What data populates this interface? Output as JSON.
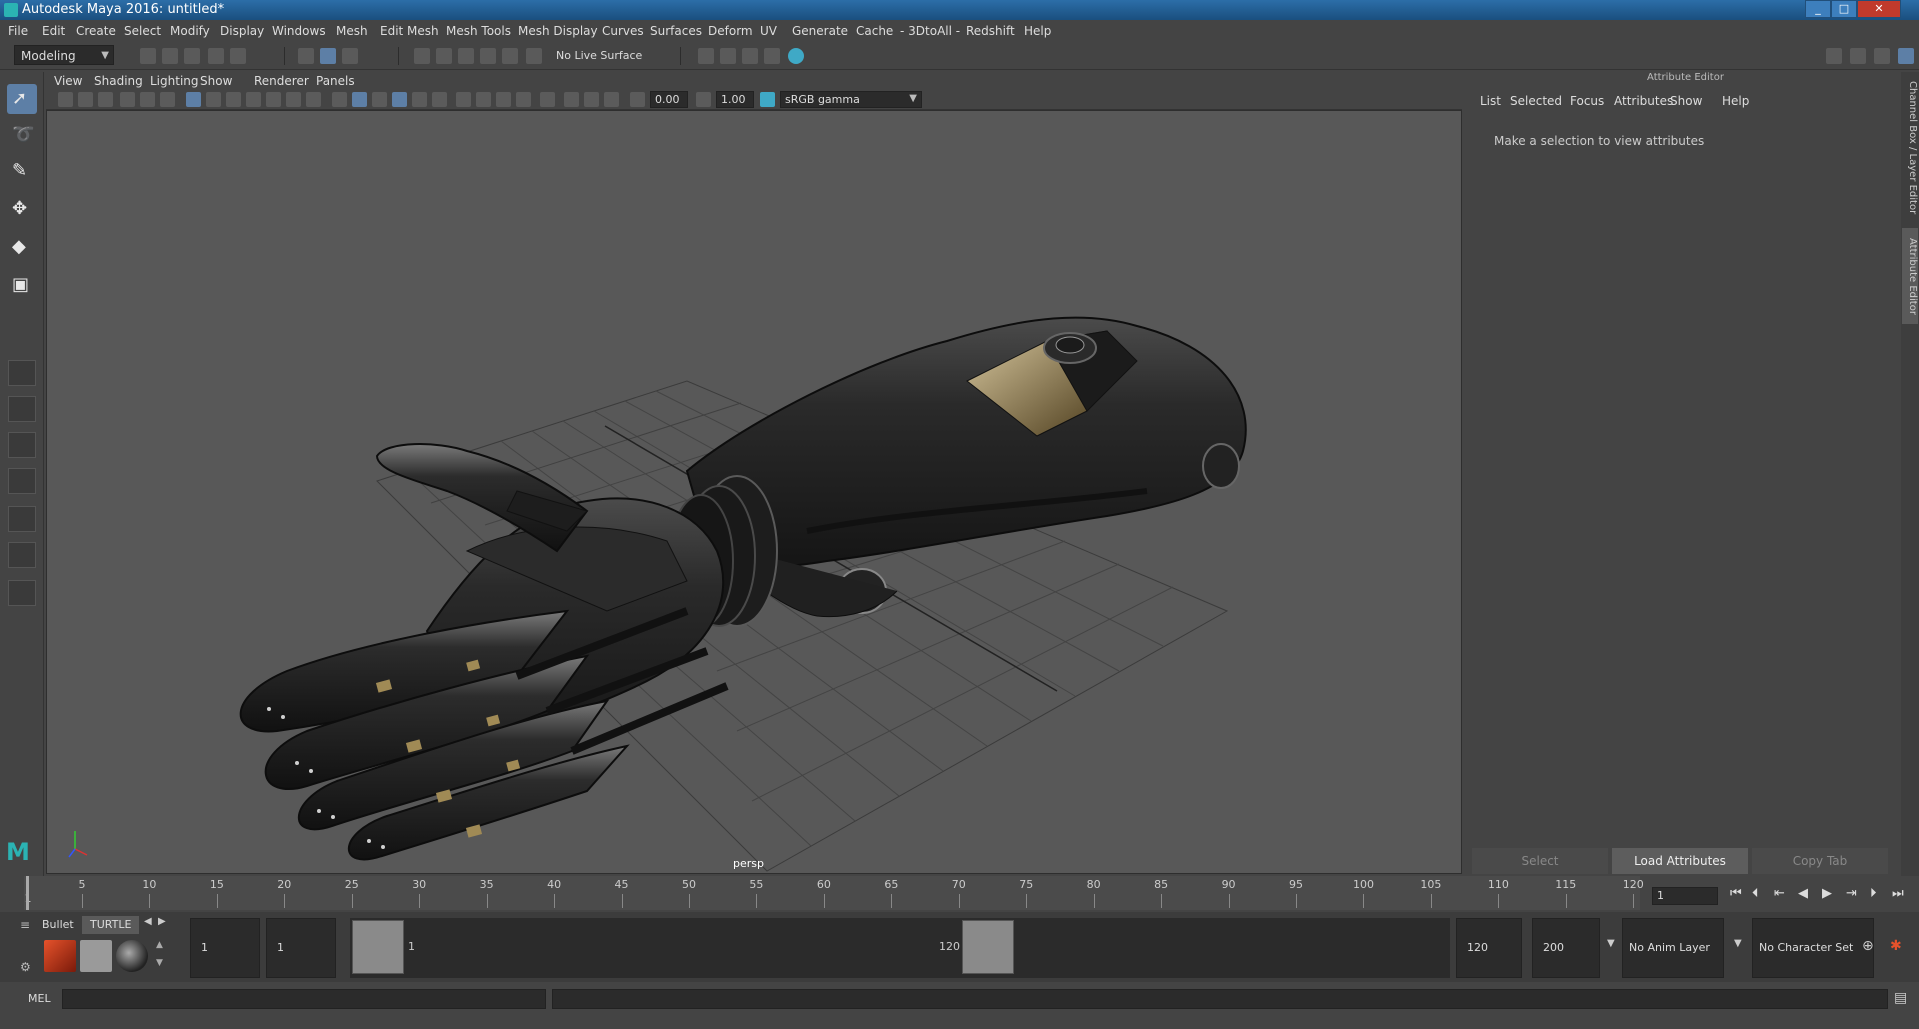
{
  "window": {
    "title": "Autodesk Maya 2016: untitled*",
    "min": "_",
    "max": "□",
    "close": "✕"
  },
  "menubar": [
    "File",
    "Edit",
    "Create",
    "Select",
    "Modify",
    "Display",
    "Windows",
    "Mesh",
    "Edit Mesh",
    "Mesh Tools",
    "Mesh Display",
    "Curves",
    "Surfaces",
    "Deform",
    "UV",
    "Generate",
    "Cache",
    "- 3DtoAll -",
    "Redshift",
    "Help"
  ],
  "statusline": {
    "menuset": "Modeling",
    "live_surface": "No Live Surface"
  },
  "panel_menu": [
    "View",
    "Shading",
    "Lighting",
    "Show",
    "Renderer",
    "Panels"
  ],
  "panel_toolbar": {
    "exposure": "0.00",
    "gamma": "1.00",
    "color_space": "sRGB gamma"
  },
  "viewport": {
    "camera": "persp"
  },
  "attribute_editor": {
    "header": "Attribute Editor",
    "menu": [
      "List",
      "Selected",
      "Focus",
      "Attributes",
      "Show",
      "Help"
    ],
    "message": "Make a selection to view attributes",
    "buttons": {
      "select": "Select",
      "load": "Load Attributes",
      "copy": "Copy Tab"
    }
  },
  "side_tabs": {
    "channel_box": "Channel Box / Layer Editor",
    "attribute_editor": "Attribute Editor"
  },
  "timeline": {
    "ticks": [
      "5",
      "10",
      "15",
      "20",
      "25",
      "30",
      "35",
      "40",
      "45",
      "50",
      "55",
      "60",
      "65",
      "70",
      "75",
      "80",
      "85",
      "90",
      "95",
      "100",
      "105",
      "110",
      "115",
      "120"
    ],
    "start_label": "1",
    "current_frame": "1"
  },
  "shelf": {
    "tabs": [
      "Bullet",
      "TURTLE"
    ]
  },
  "range": {
    "start_time": "1",
    "playback_start": "1",
    "range_start_label": "1",
    "range_end_label": "120",
    "playback_end": "120",
    "end_time": "200",
    "anim_layer": "No Anim Layer",
    "character_set": "No Character Set"
  },
  "cmdline": {
    "label": "MEL"
  },
  "icons": {
    "select_tool": "arrow-select-icon",
    "lasso_tool": "lasso-icon",
    "paint_tool": "paint-brush-icon",
    "move_tool": "move-icon",
    "rotate_tool": "rotate-icon",
    "scale_tool": "scale-icon"
  }
}
